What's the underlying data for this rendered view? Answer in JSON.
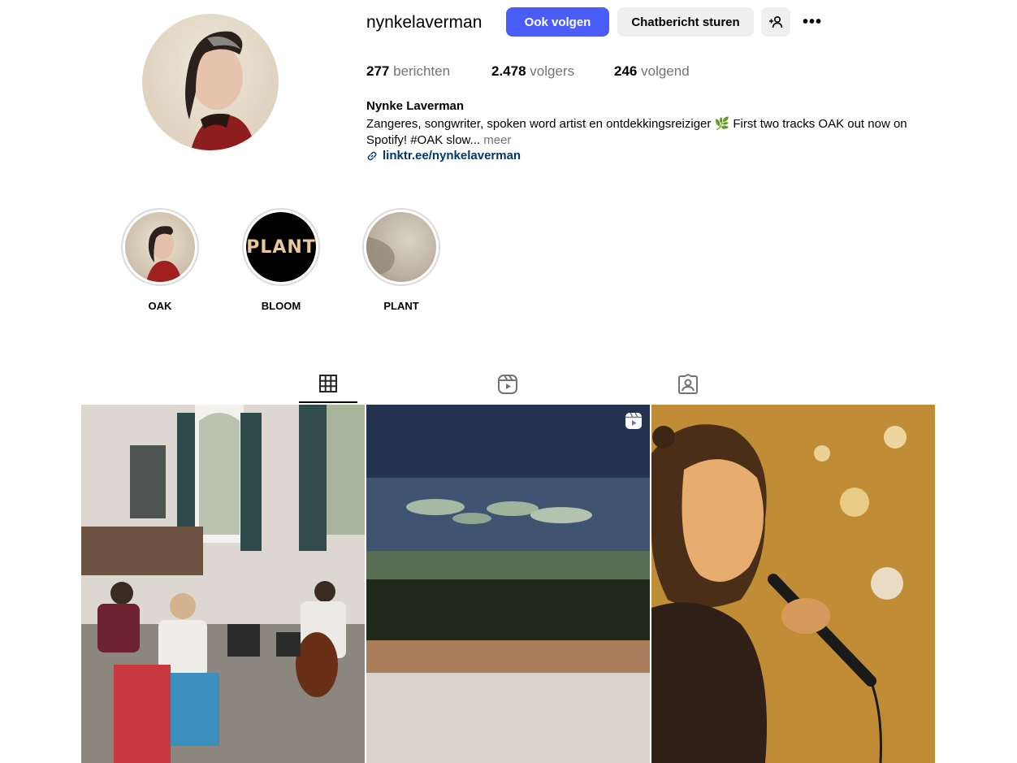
{
  "profile": {
    "username": "nynkelaverman",
    "full_name": "Nynke Laverman",
    "bio_text": "Zangeres, songwriter, spoken word artist en ontdekkingsreiziger 🌿  First two tracks OAK out now on Spotify! #OAK slow...",
    "bio_more": " meer",
    "link": "linktr.ee/nynkelaverman"
  },
  "actions": {
    "follow_label": "Ook volgen",
    "message_label": "Chatbericht sturen",
    "suggest_icon": "add-person-icon",
    "more_label": "•••"
  },
  "stats": {
    "posts_count": "277",
    "posts_label": "berichten",
    "followers_count": "2.478",
    "followers_label": "volgers",
    "following_count": "246",
    "following_label": "volgend"
  },
  "highlights": [
    {
      "label": "OAK"
    },
    {
      "label": "BLOOM",
      "cover_text": "PLANT"
    },
    {
      "label": "PLANT"
    }
  ],
  "tabs": [
    {
      "icon": "grid-icon",
      "active": true
    },
    {
      "icon": "reels-icon",
      "active": false
    },
    {
      "icon": "tagged-icon",
      "active": false
    }
  ],
  "posts": [
    {
      "description": "string ensemble rehearsal in church",
      "type": "image"
    },
    {
      "description": "water lilies and reeds reflection",
      "type": "reel"
    },
    {
      "description": "singer with microphone on stage",
      "type": "image"
    }
  ],
  "colors": {
    "accent": "#4a5df9",
    "secondary_button": "#efefef",
    "muted_text": "#737373",
    "link": "#00376b"
  }
}
